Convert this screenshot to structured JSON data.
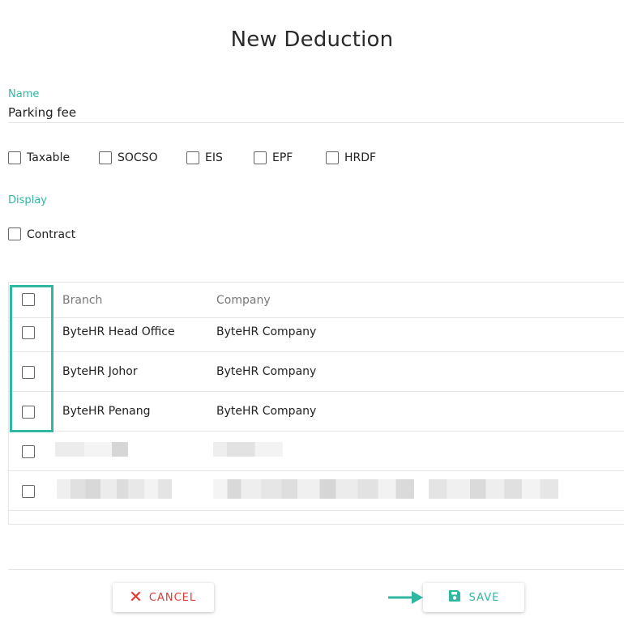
{
  "dialog": {
    "title": "New Deduction"
  },
  "form": {
    "name_label": "Name",
    "name_value": "Parking fee",
    "statutory_options": [
      {
        "label": "Taxable",
        "checked": false
      },
      {
        "label": "SOCSO",
        "checked": false
      },
      {
        "label": "EIS",
        "checked": false
      },
      {
        "label": "EPF",
        "checked": false
      },
      {
        "label": "HRDF",
        "checked": false
      }
    ],
    "display_label": "Display",
    "display_options": [
      {
        "label": "Contract",
        "checked": false
      }
    ]
  },
  "table": {
    "columns": [
      "Branch",
      "Company"
    ],
    "rows": [
      {
        "branch": "ByteHR Head Office",
        "company": "ByteHR Company",
        "checked": false
      },
      {
        "branch": "ByteHR Johor",
        "company": "ByteHR Company",
        "checked": false
      },
      {
        "branch": "ByteHR Penang",
        "company": "ByteHR Company",
        "checked": false
      }
    ]
  },
  "actions": {
    "cancel_label": "CANCEL",
    "save_label": "SAVE"
  },
  "colors": {
    "accent": "#2fb7a1",
    "danger": "#e53935"
  },
  "icons": {
    "cancel": "close-icon",
    "save": "floppy-disk-icon",
    "pointer": "arrow-right-icon"
  }
}
